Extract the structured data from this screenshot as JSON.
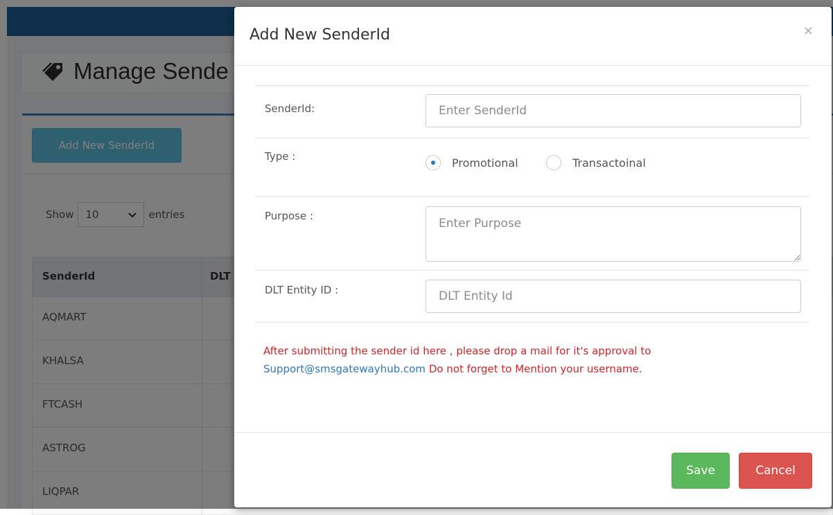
{
  "background": {
    "page_title": "Manage Sende",
    "add_button_label": "Add New SenderId",
    "show_label": "Show",
    "entries_value": "10",
    "entries_label": "entries",
    "table": {
      "columns": [
        "SenderId",
        "DLT"
      ],
      "rows": [
        "AQMART",
        "KHALSA",
        "FTCASH",
        "ASTROG",
        "LIQPAR"
      ]
    }
  },
  "modal": {
    "title": "Add New SenderId",
    "close_symbol": "×",
    "senderid_label": "SenderId:",
    "senderid_placeholder": "Enter SenderId",
    "type_label": "Type :",
    "type_options": [
      "Promotional",
      "Transactoinal"
    ],
    "type_selected": "Promotional",
    "purpose_label": "Purpose :",
    "purpose_placeholder": "Enter Purpose",
    "dlt_label": "DLT Entity ID :",
    "dlt_placeholder": "DLT Entity Id",
    "notice_part1": "After submitting the sender id here , please drop a mail for it's approval to",
    "notice_email": "Support@smsgatewayhub.com",
    "notice_part2": " Do not forget to Mention your username.",
    "save_label": "Save",
    "cancel_label": "Cancel"
  },
  "colors": {
    "header_blue": "#1f5f95",
    "save_green": "#5cb85c",
    "cancel_red": "#d9534f",
    "notice_red": "#c9262a",
    "link_blue": "#2f78b8"
  }
}
